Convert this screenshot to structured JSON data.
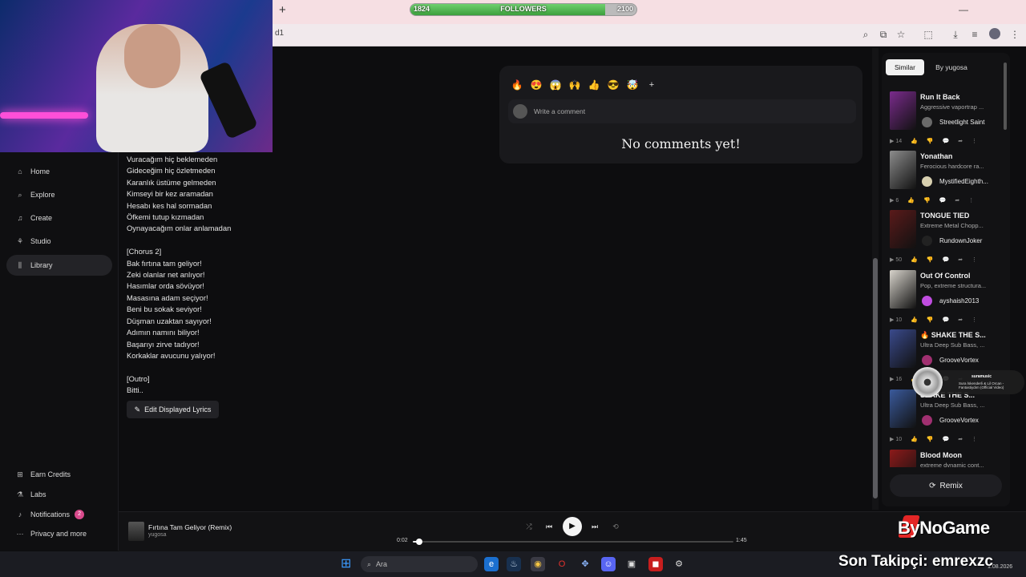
{
  "browser": {
    "new_tab": "+",
    "address_fragment": "d1",
    "minimize": "—"
  },
  "followers_bar": {
    "start": "1824",
    "label": "FOLLOWERS",
    "end": "2100",
    "progress": 0.86
  },
  "sidebar": {
    "items": [
      {
        "label": "Home",
        "icon": "home-icon"
      },
      {
        "label": "Explore",
        "icon": "search-icon"
      },
      {
        "label": "Create",
        "icon": "music-note-icon"
      },
      {
        "label": "Studio",
        "icon": "studio-icon"
      },
      {
        "label": "Library",
        "icon": "library-icon",
        "active": true
      }
    ],
    "bottom_items": [
      {
        "label": "Earn Credits",
        "icon": "gift-icon"
      },
      {
        "label": "Labs",
        "icon": "flask-icon"
      },
      {
        "label": "Notifications",
        "icon": "bell-icon",
        "badge": "2"
      },
      {
        "label": "Privacy and more",
        "icon": "dots-icon"
      }
    ]
  },
  "lyrics": {
    "text": "Vuracağım hiç beklemeden\nGideceğim hiç özletmeden\nKaranlık üstüme gelmeden\nKimseyi bir kez aramadan\nHesabı kes hal sormadan\nÖfkemi tutup kızmadan\nOynayacağım onlar anlamadan\n\n[Chorus 2]\nBak fırtına tam geliyor!\nZeki olanlar net anlıyor!\nHasımlar orda sövüyor!\nMasasına adam seçiyor!\nBeni bu sokak seviyor!\nDüşman uzaktan sayıyor!\nAdımın namını biliyor!\nBaşarıyı zirve tadıyor!\nKorkaklar avucunu yalıyor!\n\n[Outro]\nBitti..",
    "edit_label": "Edit Displayed Lyrics"
  },
  "comments": {
    "reactions": [
      "🔥",
      "😍",
      "😱",
      "🙌",
      "👍",
      "😎",
      "🤯"
    ],
    "add_reaction": "+",
    "placeholder": "Write a comment",
    "empty_text": "No comments yet!"
  },
  "right_panel": {
    "tabs": [
      "Similar",
      "By yugosa"
    ],
    "songs": [
      {
        "title": "Run It Back",
        "desc": "Aggressive vaportrap ...",
        "artist": "Streetlight Saint",
        "plays": "14",
        "cover": "#7a2b8c",
        "avatar": "#6a6a6a"
      },
      {
        "title": "Yonathan",
        "desc": "Ferocious hardcore ra...",
        "artist": "MystifiedEighth...",
        "plays": "6",
        "cover": "#8c8c8c",
        "avatar": "#d8d0b0"
      },
      {
        "title": "TONGUE TIED",
        "desc": "Extreme Metal Chopp...",
        "artist": "RundownJoker",
        "plays": "50",
        "cover": "#5a1a1a",
        "avatar": "#222222"
      },
      {
        "title": "Out Of Control",
        "desc": "Pop, extreme structura...",
        "artist": "ayshaish2013",
        "plays": "10",
        "cover": "#d8d4cc",
        "avatar": "#c04de0"
      },
      {
        "title": "🔥 SHAKE THE S...",
        "desc": "Ultra Deep Sub Bass, ...",
        "artist": "GrooveVortex",
        "plays": "16",
        "cover": "#3a4a8c",
        "avatar": "#a03070"
      },
      {
        "title": "SHAKE THE S...",
        "desc": "Ultra Deep Sub Bass, ...",
        "artist": "GrooveVortex",
        "plays": "10",
        "cover": "#3a5a9c",
        "avatar": "#a03070"
      },
      {
        "title": "Blood Moon",
        "desc": "extreme dynamic cont...",
        "artist": "",
        "plays": "",
        "cover": "#8c1a1a",
        "avatar": "#333333"
      }
    ],
    "remix_label": "Remix"
  },
  "mini_popup": {
    "title": "suramusic",
    "subtitle": "Sura İskenderli & Lil Orcan - Fantastiydım (Official Video)"
  },
  "player": {
    "title": "Fırtına Tam Geliyor (Remix)",
    "artist": "yugosa",
    "current_time": "0:02",
    "total_time": "1:45",
    "progress": 0.02
  },
  "overlay": {
    "watermark": "ByNoGame",
    "last_follower": "Son Takipçi: emrexzc"
  },
  "taskbar": {
    "search_placeholder": "Ara",
    "clock": "1.08.2026"
  }
}
